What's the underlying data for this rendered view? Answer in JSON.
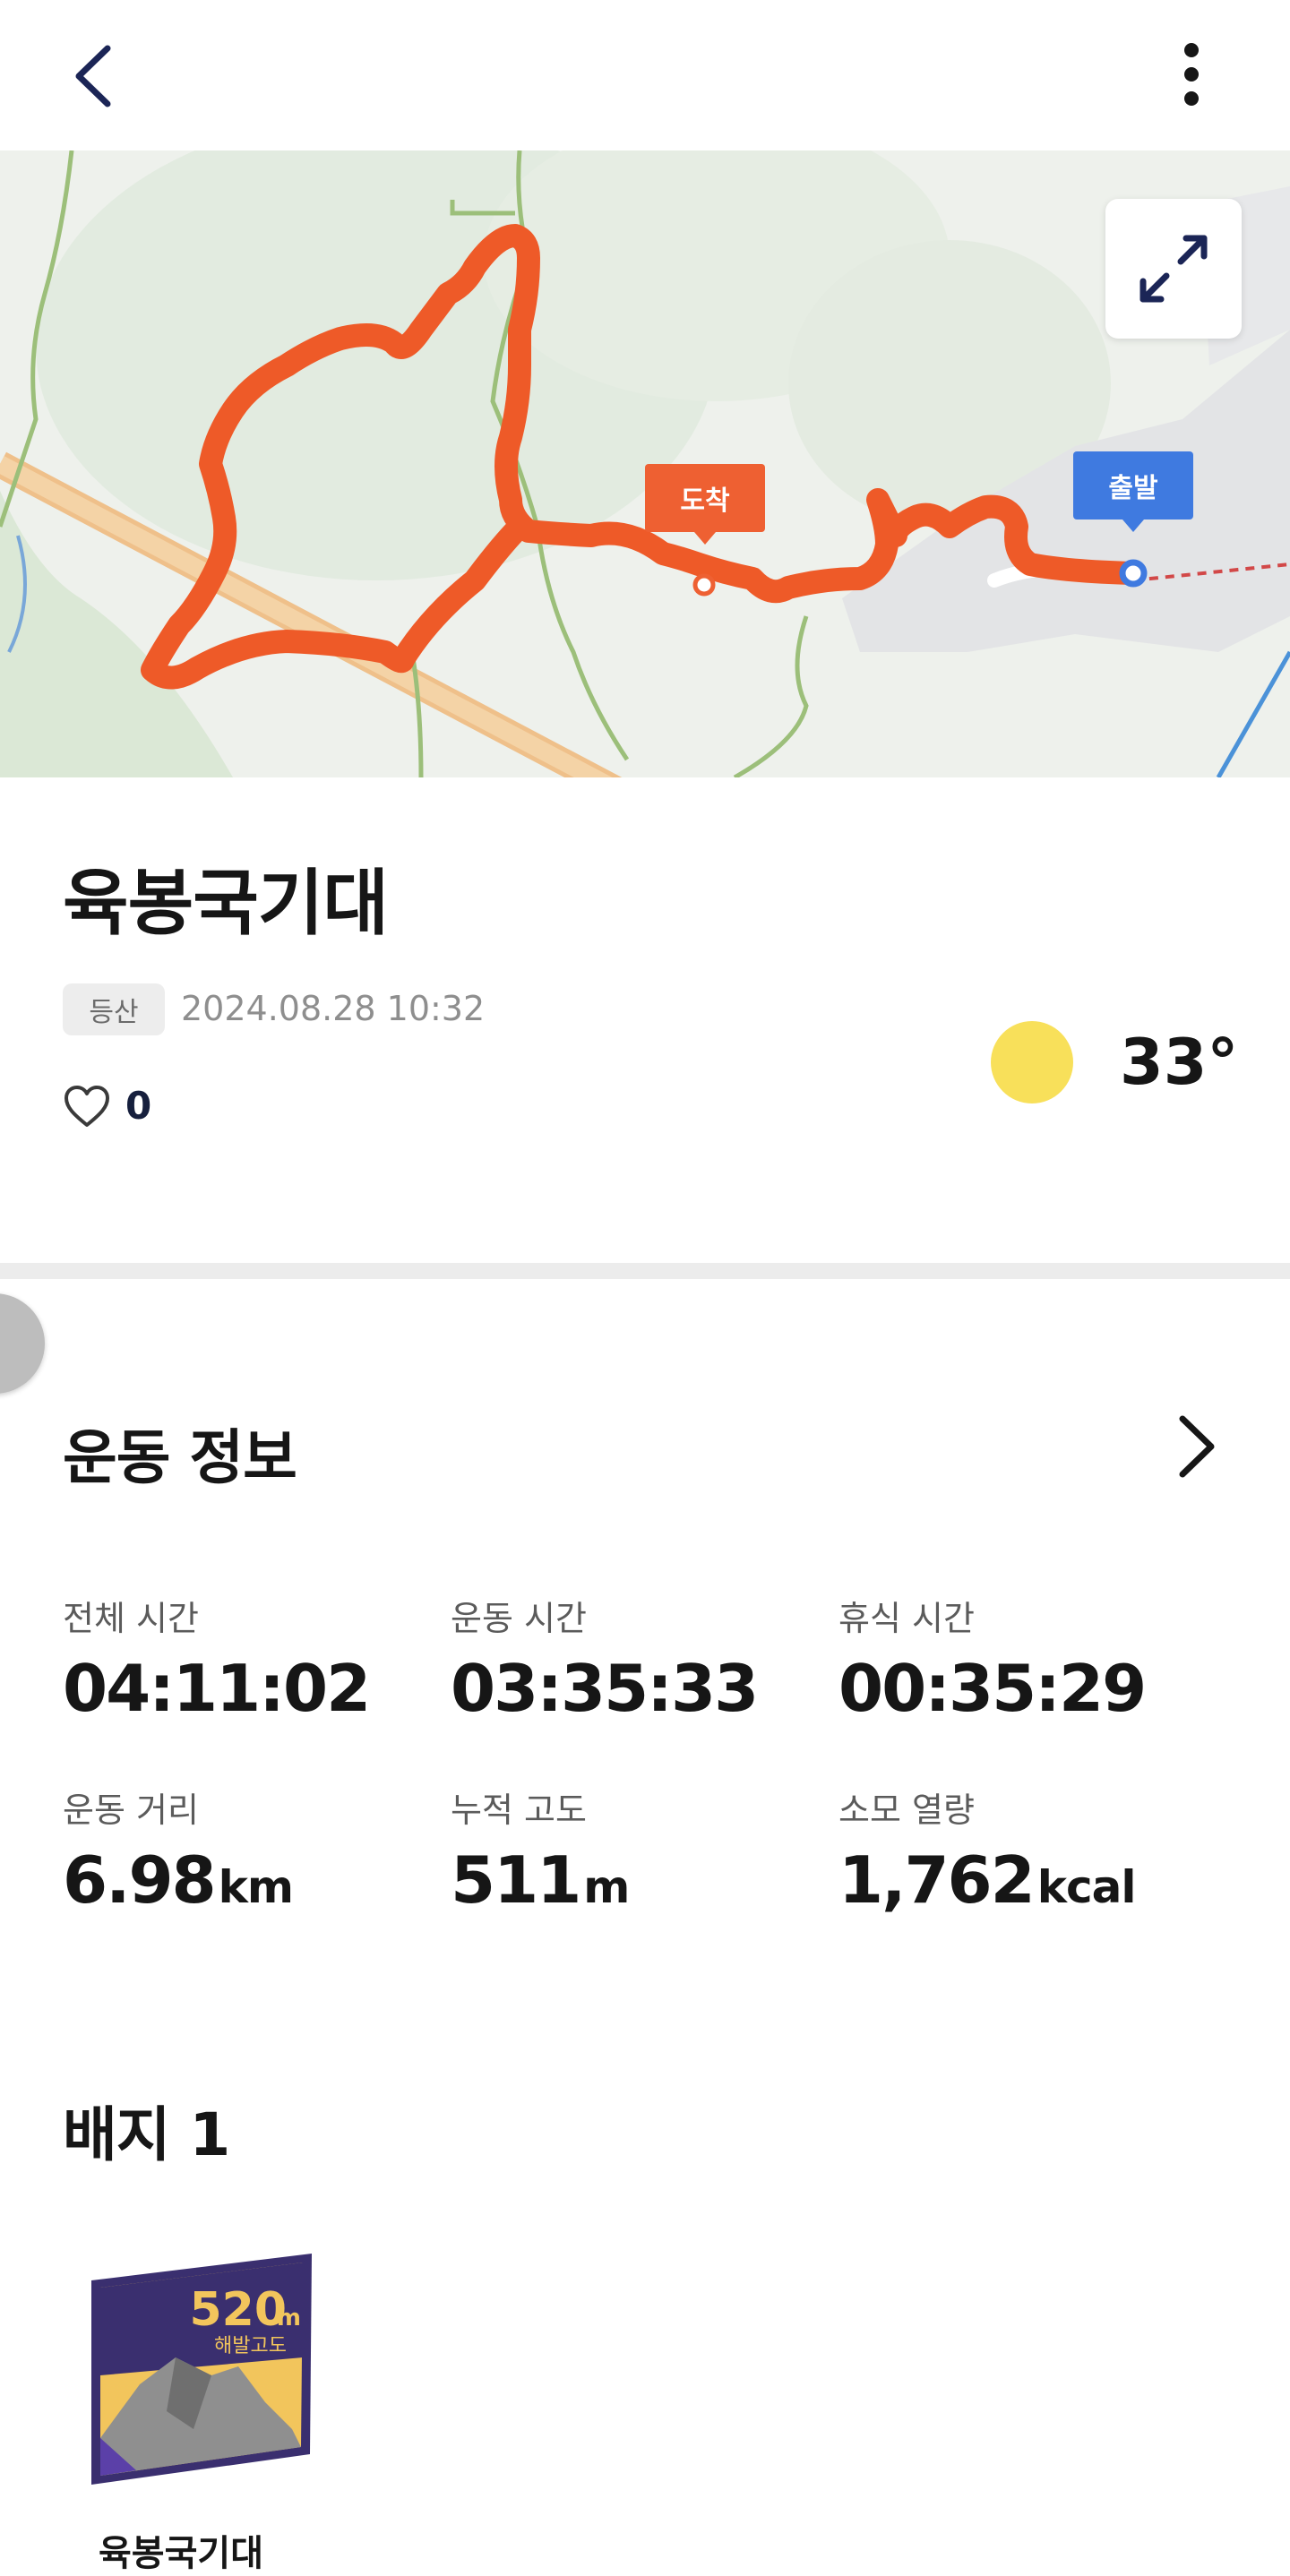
{
  "header": {
    "back_icon": "chevron-left-icon",
    "more_icon": "vertical-dots-icon"
  },
  "map": {
    "expand_icon": "expand-arrows-icon",
    "arrival_label": "도착",
    "start_label": "출발",
    "route_color": "#ee5a28",
    "arrival_color": "#ee6032",
    "start_color": "#3f7ae0"
  },
  "activity": {
    "title": "육봉국기대",
    "type": "등산",
    "datetime": "2024.08.28 10:32",
    "like_icon": "heart-outline-icon",
    "likes": "0",
    "weather_icon": "sun-icon",
    "temperature": "33°"
  },
  "exercise_info": {
    "title": "운동 정보",
    "chevron_icon": "chevron-right-icon",
    "stats": [
      {
        "label": "전체 시간",
        "value": "04:11:02",
        "unit": ""
      },
      {
        "label": "운동 시간",
        "value": "03:35:33",
        "unit": ""
      },
      {
        "label": "휴식 시간",
        "value": "00:35:29",
        "unit": ""
      },
      {
        "label": "운동 거리",
        "value": "6.98",
        "unit": "km"
      },
      {
        "label": "누적 고도",
        "value": "511",
        "unit": "m"
      },
      {
        "label": "소모 열량",
        "value": "1,762",
        "unit": "kcal"
      }
    ]
  },
  "badges": {
    "title": "배지 1",
    "items": [
      {
        "altitude": "520",
        "altitude_unit": "m",
        "subtitle": "해발고도",
        "caption": "육봉국기대"
      }
    ]
  },
  "colors": {
    "badge_frame": "#3a2f6f",
    "badge_yellow": "#f2c55c",
    "badge_rock": "#8f8f8f"
  }
}
